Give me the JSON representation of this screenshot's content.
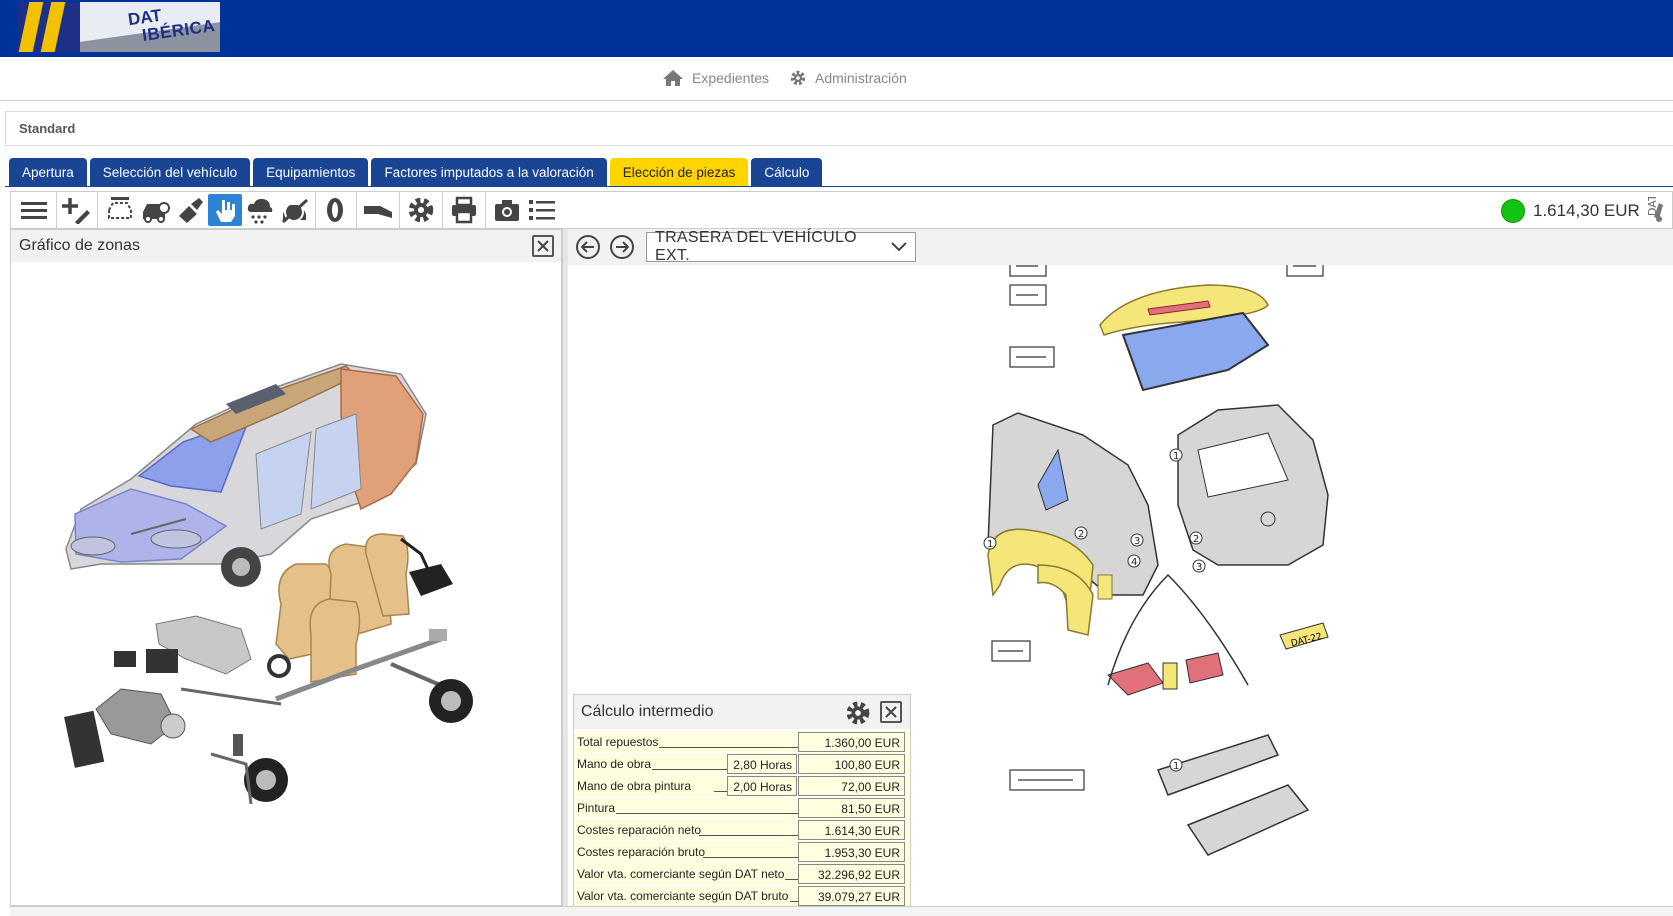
{
  "brand": {
    "line1": "DAT",
    "line2": "IBÉRICA"
  },
  "nav": {
    "expedientes": "Expedientes",
    "administracion": "Administración"
  },
  "section": "Standard",
  "tabs": [
    {
      "label": "Apertura",
      "active": false
    },
    {
      "label": "Selección del vehículo",
      "active": false
    },
    {
      "label": "Equipamientos",
      "active": false
    },
    {
      "label": "Factores imputados a la valoración",
      "active": false
    },
    {
      "label": "Elección de piezas",
      "active": true
    },
    {
      "label": "Cálculo",
      "active": false
    }
  ],
  "toolbar": {
    "icons": [
      "menu-icon",
      "add-edit-icon",
      "vehicle-select-icon",
      "car-damage-icon",
      "paint-icon",
      "hand-select-icon",
      "hail-icon",
      "no-car-icon",
      "tire-icon",
      "pipe-icon",
      "settings-icon",
      "print-icon",
      "camera-icon",
      "list-icon"
    ],
    "total": "1.614,30 EUR",
    "status_color": "#13c413"
  },
  "left_panel": {
    "title": "Gráfico de zonas"
  },
  "right_panel": {
    "zone": "TRASERA DEL VEHÍCULO EXT."
  },
  "calc": {
    "title": "Cálculo intermedio",
    "rows": [
      {
        "label": "Total repuestos",
        "hours": null,
        "value": "1.360,00 EUR"
      },
      {
        "label": "Mano de obra",
        "hours": "2,80 Horas",
        "value": "100,80 EUR"
      },
      {
        "label": "Mano de obra pintura",
        "hours": "2,00 Horas",
        "value": "72,00 EUR"
      },
      {
        "label": "Pintura",
        "hours": null,
        "value": "81,50 EUR"
      },
      {
        "label": "Costes reparación neto",
        "hours": null,
        "value": "1.614,30 EUR"
      },
      {
        "label": "Costes reparación bruto",
        "hours": null,
        "value": "1.953,30 EUR"
      },
      {
        "label": "Valor vta. comerciante según DAT neto",
        "hours": null,
        "value": "32.296,92 EUR"
      },
      {
        "label": "Valor vta. comerciante según DAT bruto",
        "hours": null,
        "value": "39.079,27 EUR"
      }
    ]
  },
  "diagram": {
    "callouts": [
      "1",
      "2",
      "3",
      "4",
      "1",
      "2",
      "3",
      "1"
    ],
    "plate_text": "DAT-22",
    "colors": {
      "yellow": "#f5e67a",
      "blue": "#8aa8ee",
      "red": "#e0707a",
      "body": "#d6d6d6",
      "tan": "#e0b07a",
      "purple": "#aeb4ea"
    }
  }
}
